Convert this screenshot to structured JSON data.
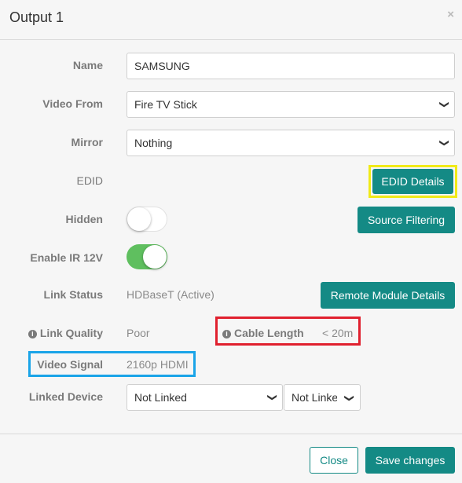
{
  "dialog": {
    "title": "Output 1",
    "close_glyph": "×"
  },
  "form": {
    "name": {
      "label": "Name",
      "value": "SAMSUNG"
    },
    "video_from": {
      "label": "Video From",
      "value": "Fire TV Stick"
    },
    "mirror": {
      "label": "Mirror",
      "value": "Nothing"
    },
    "edid": {
      "label": "EDID",
      "button": "EDID Details"
    },
    "hidden": {
      "label": "Hidden",
      "on": false,
      "button": "Source Filtering"
    },
    "enable_ir": {
      "label": "Enable IR 12V",
      "on": true
    },
    "link_status": {
      "label": "Link Status",
      "value": "HDBaseT (Active)",
      "button": "Remote Module Details"
    },
    "link_quality": {
      "label": "Link Quality",
      "value": "Poor"
    },
    "cable_length": {
      "label": "Cable Length",
      "value": "< 20m"
    },
    "video_signal": {
      "label": "Video Signal",
      "value": "2160p HDMI"
    },
    "linked_device": {
      "label": "Linked Device",
      "value1": "Not Linked",
      "value2": "Not Linked"
    }
  },
  "footer": {
    "close": "Close",
    "save": "Save changes"
  },
  "icons": {
    "info": "info-icon",
    "close": "close-icon",
    "chevron": "chevron-down-icon"
  },
  "colors": {
    "accent": "#148a85",
    "toggle_on": "#5fbf5f",
    "highlight_yellow": "#f0ea17",
    "highlight_red": "#e0202e",
    "highlight_blue": "#1aa4e8"
  }
}
